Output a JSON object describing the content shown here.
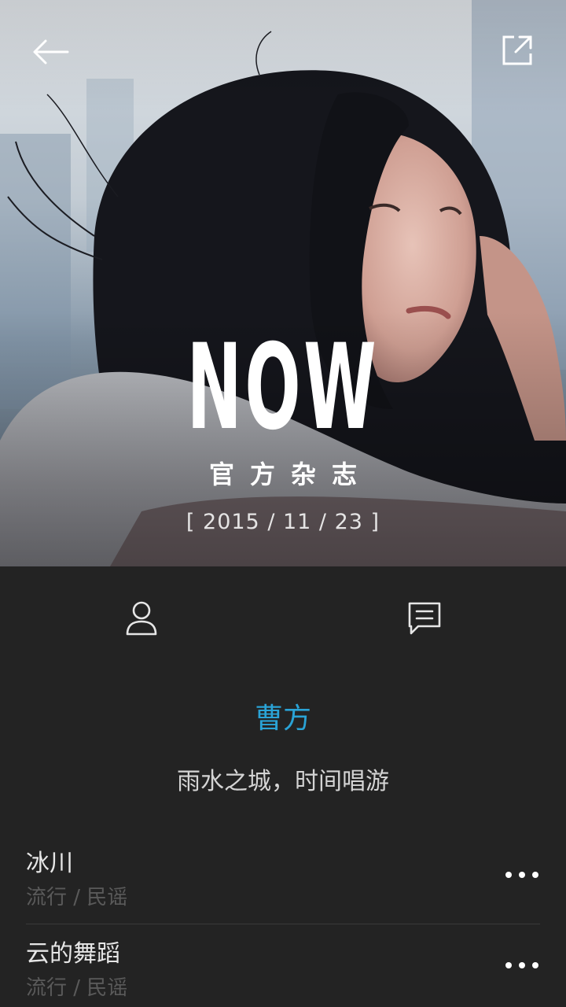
{
  "hero": {
    "title": "NOW",
    "subtitle": "官方杂志",
    "date": "[ 2015 / 11 / 23 ]",
    "back_icon": "arrow-left-icon",
    "share_icon": "share-external-icon"
  },
  "actions": {
    "artist_icon": "person-icon",
    "comment_icon": "comment-icon"
  },
  "album": {
    "artist": "曹方",
    "tagline": "雨水之城，时间唱游"
  },
  "songs": [
    {
      "title": "冰川",
      "genre": "流行 / 民谣",
      "more_icon": "more-dots-icon"
    },
    {
      "title": "云的舞蹈",
      "genre": "流行 / 民谣",
      "more_icon": "more-dots-icon"
    }
  ],
  "colors": {
    "background": "#232323",
    "accent": "#2aa3d6",
    "primary_text": "#e6e6e6",
    "secondary_text": "#5a5a5a"
  }
}
